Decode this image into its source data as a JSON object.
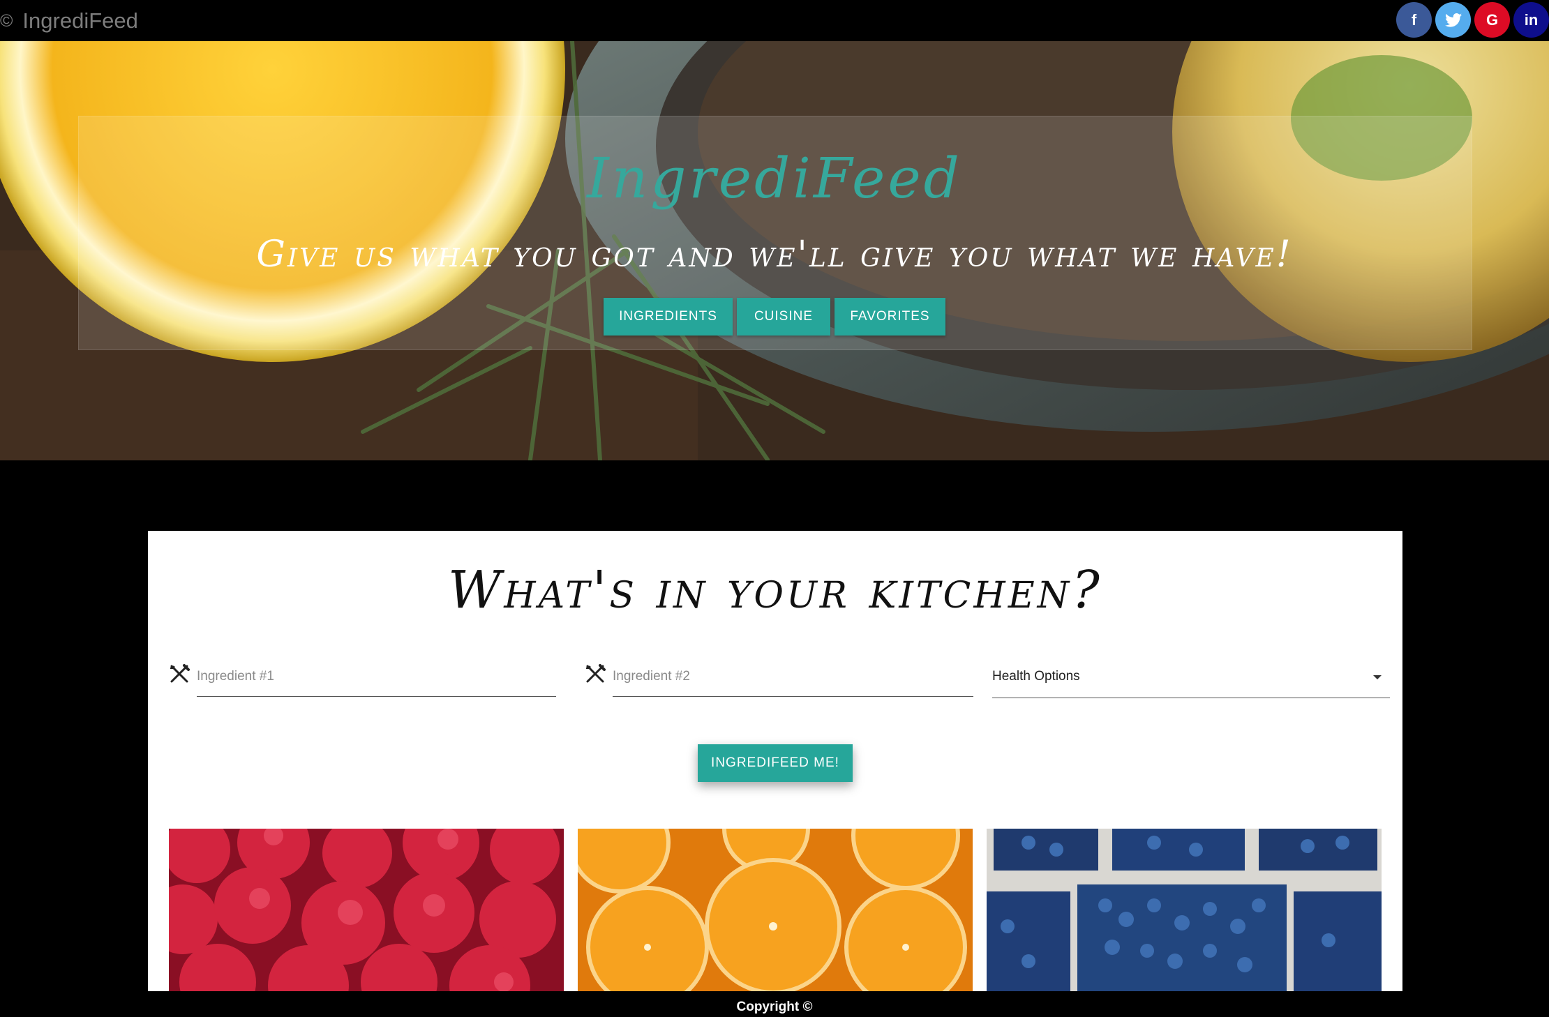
{
  "topbar": {
    "copyright_symbol": "©",
    "brand": "IngrediFeed",
    "socials": [
      {
        "label": "f",
        "icon": "facebook-icon",
        "color": "#3b5998"
      },
      {
        "label": "t",
        "icon": "twitter-icon",
        "color": "#55acee"
      },
      {
        "label": "G",
        "icon": "google-icon",
        "color": "#dd0b25"
      },
      {
        "label": "in",
        "icon": "linkedin-icon",
        "color": "#0e0e8c"
      }
    ]
  },
  "hero": {
    "title": "IngrediFeed",
    "tagline": "Give us what you got and we'll give you what we have!",
    "buttons": {
      "ingredients": "Ingredients",
      "cuisine": "Cuisine",
      "favorites": "Favorites"
    }
  },
  "search": {
    "heading": "What's in your kitchen?",
    "ingredient1_placeholder": "Ingredient #1",
    "ingredient2_placeholder": "Ingredient #2",
    "health_options_value": "Health Options",
    "submit_label": "INGREDIFEED ME!"
  },
  "tiles": [
    {
      "name": "raspberries",
      "icon": "raspberries-image"
    },
    {
      "name": "oranges",
      "icon": "oranges-image"
    },
    {
      "name": "blueberries",
      "icon": "blueberries-image"
    }
  ],
  "footer": {
    "copyright": "Copyright ©"
  },
  "colors": {
    "accent": "#26a69a",
    "title_teal": "#36a89c",
    "facebook": "#3b5998",
    "twitter": "#55acee",
    "google": "#dd0b25",
    "linkedin": "#0e0e8c"
  }
}
